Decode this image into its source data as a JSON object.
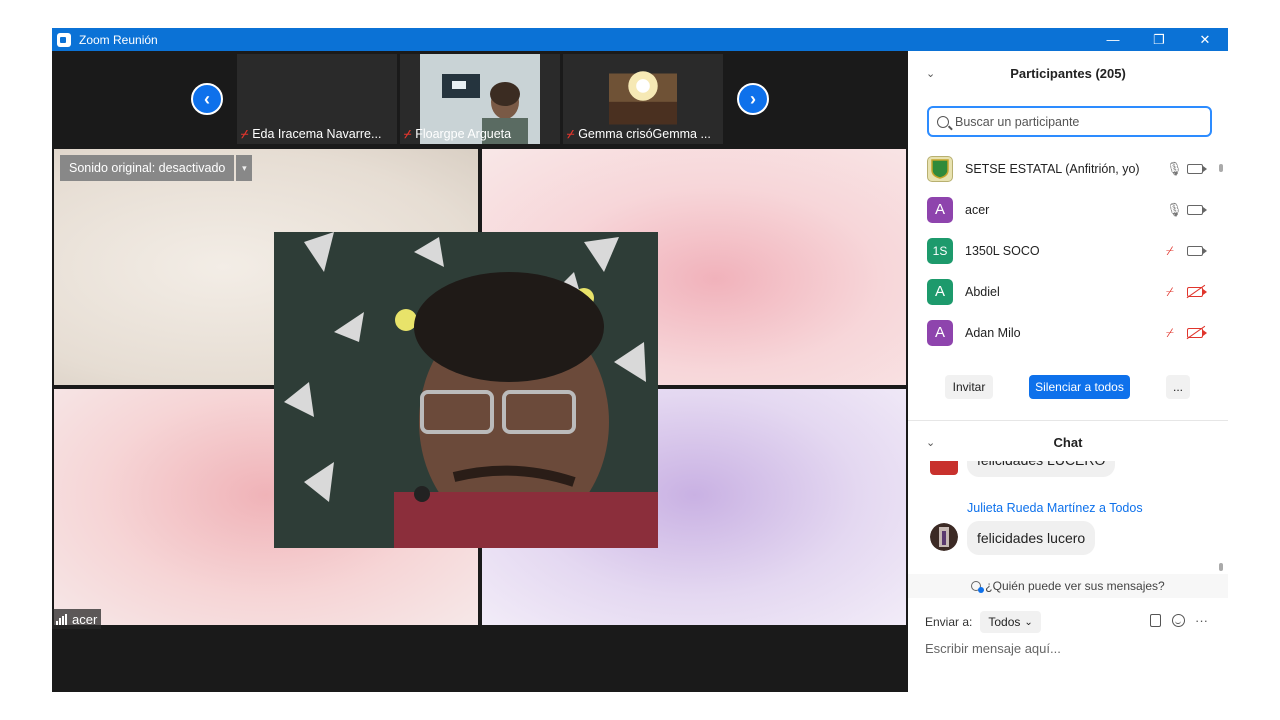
{
  "window": {
    "title": "Zoom Reunión",
    "minimize": "—",
    "restore": "❐",
    "close": "✕"
  },
  "strip": {
    "prev_arrow": "‹",
    "next_arrow": "›",
    "thumbs": [
      {
        "name": "Eda Iracema Navarre..."
      },
      {
        "name": "Floargpe Argueta"
      },
      {
        "name": "Gemma crisóGemma ..."
      }
    ]
  },
  "stage": {
    "original_sound": "Sonido original: desactivado",
    "dropdown": "▾",
    "speaker": "acer"
  },
  "participants": {
    "title": "Participantes (205)",
    "search_placeholder": "Buscar un participante",
    "list": [
      {
        "initials": "",
        "name": "SETSE ESTATAL (Anfitrión, yo)",
        "color": "#e8e2b0",
        "mic": "on",
        "cam": "on"
      },
      {
        "initials": "A",
        "name": "acer",
        "color": "#8e44ad",
        "mic": "on",
        "cam": "on"
      },
      {
        "initials": "1S",
        "name": "1350L SOCO",
        "color": "#1d9a6c",
        "mic": "off",
        "cam": "on"
      },
      {
        "initials": "A",
        "name": "Abdiel",
        "color": "#1d9a6c",
        "mic": "off",
        "cam": "off"
      },
      {
        "initials": "A",
        "name": "Adan Milo",
        "color": "#8e44ad",
        "mic": "off",
        "cam": "off"
      }
    ],
    "invite": "Invitar",
    "mute_all": "Silenciar a todos",
    "more": "..."
  },
  "chat": {
    "title": "Chat",
    "messages": [
      {
        "sender": "",
        "text": "felicidades LUCERO"
      },
      {
        "sender": "Julieta Rueda Martínez a Todos",
        "text": "felicidades lucero"
      }
    ],
    "who_can_see": "¿Quién puede ver sus mensajes?",
    "send_to_label": "Enviar a:",
    "send_to_value": "Todos",
    "send_to_caret": "⌄",
    "input_placeholder": "Escribir mensaje aquí...",
    "more": "···"
  },
  "colors": {
    "titlebar": "#0b72d6",
    "accent": "#0e71eb",
    "muted_red": "#e0352c"
  }
}
